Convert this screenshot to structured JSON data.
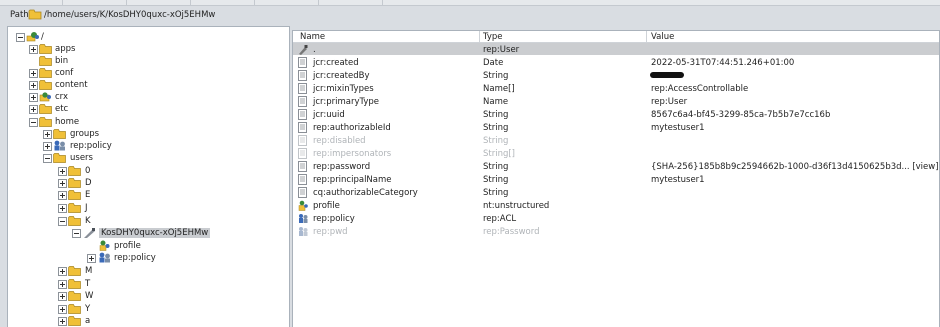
{
  "path": {
    "label": "Path",
    "value": "/home/users/K/KosDHY0quxc-xOj5EHMw"
  },
  "tree": {
    "root": "/",
    "apps": "apps",
    "bin": "bin",
    "conf": "conf",
    "content": "content",
    "crx": "crx",
    "etc": "etc",
    "home": "home",
    "groups": "groups",
    "rep_policy": "rep:policy",
    "users": "users",
    "u0": "0",
    "uD": "D",
    "uE": "E",
    "uJ": "J",
    "uK": "K",
    "selected": "KosDHY0quxc-xOj5EHMw",
    "profile": "profile",
    "sel_policy": "rep:policy",
    "uM": "M",
    "uT": "T",
    "uW": "W",
    "uY": "Y",
    "ua": "a"
  },
  "props": {
    "headers": {
      "name": "Name",
      "type": "Type",
      "value": "Value"
    },
    "rows": [
      {
        "name": ".",
        "type": "rep:User",
        "value": ""
      },
      {
        "name": "jcr:created",
        "type": "Date",
        "value": "2022-05-31T07:44:51.246+01:00"
      },
      {
        "name": "jcr:createdBy",
        "type": "String",
        "value": ""
      },
      {
        "name": "jcr:mixinTypes",
        "type": "Name[]",
        "value": "rep:AccessControllable"
      },
      {
        "name": "jcr:primaryType",
        "type": "Name",
        "value": "rep:User"
      },
      {
        "name": "jcr:uuid",
        "type": "String",
        "value": "8567c6a4-bf45-3299-85ca-7b5b7e7cc16b"
      },
      {
        "name": "rep:authorizableId",
        "type": "String",
        "value": "mytestuser1"
      },
      {
        "name": "rep:disabled",
        "type": "String",
        "value": ""
      },
      {
        "name": "rep:impersonators",
        "type": "String[]",
        "value": ""
      },
      {
        "name": "rep:password",
        "type": "String",
        "value": "{SHA-256}185b8b9c2594662b-1000-d36f13d4150625b3d... [view]"
      },
      {
        "name": "rep:principalName",
        "type": "String",
        "value": "mytestuser1"
      },
      {
        "name": "cq:authorizableCategory",
        "type": "String",
        "value": ""
      },
      {
        "name": "profile",
        "type": "nt:unstructured",
        "value": ""
      },
      {
        "name": "rep:policy",
        "type": "rep:ACL",
        "value": ""
      },
      {
        "name": "rep:pwd",
        "type": "rep:Password",
        "value": ""
      }
    ]
  },
  "colors": {
    "folder": "#f0c038",
    "selected_row": "#cbcdd0",
    "disabled_text": "#b0b4b8"
  }
}
